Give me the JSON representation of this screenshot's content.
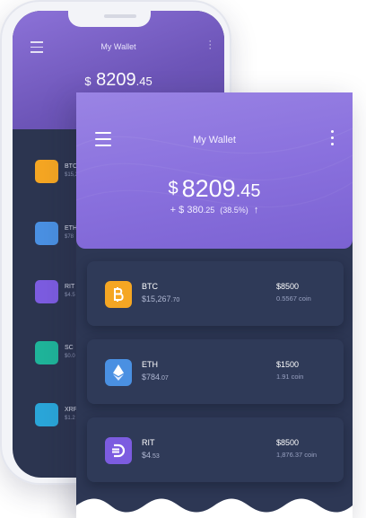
{
  "background_phone": {
    "title": "My Wallet",
    "balance_currency": "$",
    "balance_main": "8209",
    "balance_decimal": ".45",
    "rows": [
      {
        "symbol": "BTC",
        "value": "$15,2",
        "icon": "bitcoin-icon",
        "color": "#f5a623"
      },
      {
        "symbol": "ETH",
        "value": "$78",
        "icon": "ethereum-icon",
        "color": "#4a90e2"
      },
      {
        "symbol": "RIT",
        "value": "$4.5",
        "icon": "rit-icon",
        "color": "#7c5ce0"
      },
      {
        "symbol": "SC",
        "value": "$0.0",
        "icon": "siacoin-icon",
        "color": "#1fb49a"
      },
      {
        "symbol": "XRP",
        "value": "$1.2",
        "icon": "ripple-icon",
        "color": "#2aa6d9"
      }
    ]
  },
  "wallet": {
    "title": "My Wallet",
    "balance": {
      "currency": "$",
      "main": "8209",
      "decimal": ".45"
    },
    "change": {
      "prefix": "+ $",
      "main": "380",
      "decimal": ".25",
      "percent": "(38.5%)",
      "arrow": "↑"
    }
  },
  "coins": [
    {
      "symbol": "BTC",
      "price_main": "$15,267",
      "price_decimal": ".70",
      "holding": "$8500",
      "amount": "0.5567 coin",
      "icon": "bitcoin-icon",
      "color": "#f5a623"
    },
    {
      "symbol": "ETH",
      "price_main": "$784",
      "price_decimal": ".07",
      "holding": "$1500",
      "amount": "1.91 coin",
      "icon": "ethereum-icon",
      "color": "#4a90e2"
    },
    {
      "symbol": "RIT",
      "price_main": "$4",
      "price_decimal": ".53",
      "holding": "$8500",
      "amount": "1,876.37 coin",
      "icon": "rit-icon",
      "color": "#7c5ce0"
    }
  ]
}
